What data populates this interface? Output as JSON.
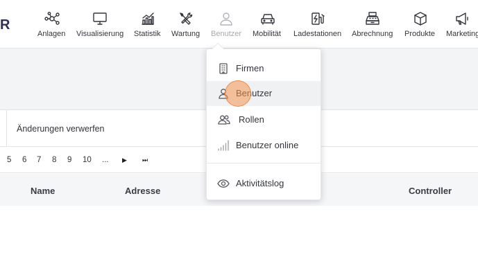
{
  "brand": {
    "letter": "R"
  },
  "nav": [
    {
      "label": "Anlagen",
      "icon": "network-nodes-icon"
    },
    {
      "label": "Visualisierung",
      "icon": "monitor-icon"
    },
    {
      "label": "Statistik",
      "icon": "bar-chart-icon"
    },
    {
      "label": "Wartung",
      "icon": "tools-icon"
    },
    {
      "label": "Benutzer",
      "icon": "user-icon",
      "state": "open"
    },
    {
      "label": "Mobilität",
      "icon": "car-icon"
    },
    {
      "label": "Ladestationen",
      "icon": "charging-station-icon"
    },
    {
      "label": "Abrechnung",
      "icon": "cash-register-icon"
    },
    {
      "label": "Produkte",
      "icon": "box-icon"
    },
    {
      "label": "Marketing",
      "icon": "megaphone-icon"
    }
  ],
  "toolbar": {
    "discard_label": "Änderungen verwerfen"
  },
  "pager": {
    "pages": [
      "5",
      "6",
      "7",
      "8",
      "9",
      "10",
      "..."
    ],
    "next": "▶",
    "last": "⏭"
  },
  "table": {
    "columns": [
      "Name",
      "Adresse",
      "Controller"
    ]
  },
  "dropdown": {
    "items": [
      {
        "label": "Firmen",
        "icon": "building-icon"
      },
      {
        "label": "Benutzer",
        "icon": "user-icon",
        "active": true
      },
      {
        "label": "Rollen",
        "icon": "users-icon"
      },
      {
        "label": "Benutzer online",
        "icon": "signal-bars-icon"
      },
      {
        "label": "Aktivitätslog",
        "icon": "eye-icon"
      }
    ]
  },
  "colors": {
    "brand": "#2c2e5b",
    "hover": "#f0f1f3",
    "click_marker": "#f49650"
  }
}
